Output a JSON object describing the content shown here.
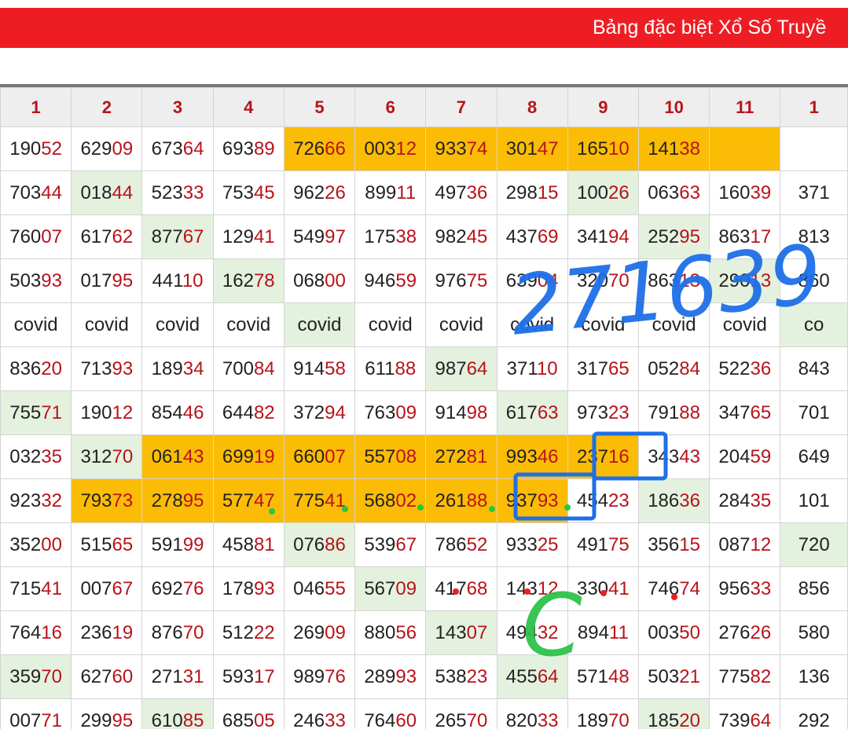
{
  "banner": {
    "title": "Bảng đặc biệt Xổ Số Truyề"
  },
  "colors": {
    "banner": "#ee1d24",
    "highlight_orange": "#fbbc05",
    "highlight_green": "#e3f1de",
    "tail_digits": "#b8131b"
  },
  "table": {
    "headers": [
      "1",
      "2",
      "3",
      "4",
      "5",
      "6",
      "7",
      "8",
      "9",
      "10",
      "11",
      "1"
    ],
    "rows": [
      [
        {
          "t": "19052",
          "s": "w"
        },
        {
          "t": "62909",
          "s": "w"
        },
        {
          "t": "67364",
          "s": "w"
        },
        {
          "t": "69389",
          "s": "w"
        },
        {
          "t": "72666",
          "s": "o"
        },
        {
          "t": "00312",
          "s": "o"
        },
        {
          "t": "93374",
          "s": "o"
        },
        {
          "t": "30147",
          "s": "o"
        },
        {
          "t": "16510",
          "s": "o"
        },
        {
          "t": "14138",
          "s": "o"
        },
        {
          "t": "",
          "s": "o"
        },
        {
          "t": "",
          "s": "w"
        }
      ],
      [
        {
          "t": "70344",
          "s": "w"
        },
        {
          "t": "01844",
          "s": "g"
        },
        {
          "t": "52333",
          "s": "w"
        },
        {
          "t": "75345",
          "s": "w"
        },
        {
          "t": "96226",
          "s": "w"
        },
        {
          "t": "89911",
          "s": "w"
        },
        {
          "t": "49736",
          "s": "w"
        },
        {
          "t": "29815",
          "s": "w"
        },
        {
          "t": "10026",
          "s": "g"
        },
        {
          "t": "06363",
          "s": "w"
        },
        {
          "t": "16039",
          "s": "w"
        },
        {
          "t": "371",
          "s": "w"
        }
      ],
      [
        {
          "t": "76007",
          "s": "w"
        },
        {
          "t": "61762",
          "s": "w"
        },
        {
          "t": "87767",
          "s": "g"
        },
        {
          "t": "12941",
          "s": "w"
        },
        {
          "t": "54997",
          "s": "w"
        },
        {
          "t": "17538",
          "s": "w"
        },
        {
          "t": "98245",
          "s": "w"
        },
        {
          "t": "43769",
          "s": "w"
        },
        {
          "t": "34194",
          "s": "w"
        },
        {
          "t": "25295",
          "s": "g"
        },
        {
          "t": "86317",
          "s": "w"
        },
        {
          "t": "813",
          "s": "w"
        }
      ],
      [
        {
          "t": "50393",
          "s": "w"
        },
        {
          "t": "01795",
          "s": "w"
        },
        {
          "t": "44110",
          "s": "w"
        },
        {
          "t": "16278",
          "s": "g"
        },
        {
          "t": "06800",
          "s": "w"
        },
        {
          "t": "94659",
          "s": "w"
        },
        {
          "t": "97675",
          "s": "w"
        },
        {
          "t": "63904",
          "s": "w"
        },
        {
          "t": "32070",
          "s": "w"
        },
        {
          "t": "86313",
          "s": "w"
        },
        {
          "t": "29013",
          "s": "g"
        },
        {
          "t": "860",
          "s": "w"
        }
      ],
      [
        {
          "t": "covid",
          "s": "w",
          "plain": true
        },
        {
          "t": "covid",
          "s": "w",
          "plain": true
        },
        {
          "t": "covid",
          "s": "w",
          "plain": true
        },
        {
          "t": "covid",
          "s": "w",
          "plain": true
        },
        {
          "t": "covid",
          "s": "g",
          "plain": true
        },
        {
          "t": "covid",
          "s": "w",
          "plain": true
        },
        {
          "t": "covid",
          "s": "w",
          "plain": true
        },
        {
          "t": "covid",
          "s": "w",
          "plain": true
        },
        {
          "t": "covid",
          "s": "w",
          "plain": true
        },
        {
          "t": "covid",
          "s": "w",
          "plain": true
        },
        {
          "t": "covid",
          "s": "w",
          "plain": true
        },
        {
          "t": "co",
          "s": "g",
          "plain": true
        }
      ],
      [
        {
          "t": "83620",
          "s": "w"
        },
        {
          "t": "71393",
          "s": "w"
        },
        {
          "t": "18934",
          "s": "w"
        },
        {
          "t": "70084",
          "s": "w"
        },
        {
          "t": "91458",
          "s": "w"
        },
        {
          "t": "61188",
          "s": "w"
        },
        {
          "t": "98764",
          "s": "g"
        },
        {
          "t": "37110",
          "s": "w"
        },
        {
          "t": "31765",
          "s": "w"
        },
        {
          "t": "05284",
          "s": "w"
        },
        {
          "t": "52236",
          "s": "w"
        },
        {
          "t": "843",
          "s": "w"
        }
      ],
      [
        {
          "t": "75571",
          "s": "g"
        },
        {
          "t": "19012",
          "s": "w"
        },
        {
          "t": "85446",
          "s": "w"
        },
        {
          "t": "64482",
          "s": "w"
        },
        {
          "t": "37294",
          "s": "w"
        },
        {
          "t": "76309",
          "s": "w"
        },
        {
          "t": "91498",
          "s": "w"
        },
        {
          "t": "61763",
          "s": "g"
        },
        {
          "t": "97323",
          "s": "w"
        },
        {
          "t": "79188",
          "s": "w"
        },
        {
          "t": "34765",
          "s": "w"
        },
        {
          "t": "701",
          "s": "w"
        }
      ],
      [
        {
          "t": "03235",
          "s": "w"
        },
        {
          "t": "31270",
          "s": "g"
        },
        {
          "t": "06143",
          "s": "o"
        },
        {
          "t": "69919",
          "s": "o"
        },
        {
          "t": "66007",
          "s": "o"
        },
        {
          "t": "55708",
          "s": "o"
        },
        {
          "t": "27281",
          "s": "o"
        },
        {
          "t": "99346",
          "s": "o"
        },
        {
          "t": "23716",
          "s": "o"
        },
        {
          "t": "34343",
          "s": "w"
        },
        {
          "t": "20459",
          "s": "w"
        },
        {
          "t": "649",
          "s": "w"
        }
      ],
      [
        {
          "t": "92332",
          "s": "w"
        },
        {
          "t": "79373",
          "s": "o"
        },
        {
          "t": "27895",
          "s": "o"
        },
        {
          "t": "57747",
          "s": "o"
        },
        {
          "t": "77541",
          "s": "o"
        },
        {
          "t": "56802",
          "s": "o"
        },
        {
          "t": "26188",
          "s": "o"
        },
        {
          "t": "93793",
          "s": "o"
        },
        {
          "t": "45423",
          "s": "w"
        },
        {
          "t": "18636",
          "s": "g"
        },
        {
          "t": "28435",
          "s": "w"
        },
        {
          "t": "101",
          "s": "w"
        }
      ],
      [
        {
          "t": "35200",
          "s": "w"
        },
        {
          "t": "51565",
          "s": "w"
        },
        {
          "t": "59199",
          "s": "w"
        },
        {
          "t": "45881",
          "s": "w"
        },
        {
          "t": "07686",
          "s": "g"
        },
        {
          "t": "53967",
          "s": "w"
        },
        {
          "t": "78652",
          "s": "w"
        },
        {
          "t": "93325",
          "s": "w"
        },
        {
          "t": "49175",
          "s": "w"
        },
        {
          "t": "35615",
          "s": "w"
        },
        {
          "t": "08712",
          "s": "w"
        },
        {
          "t": "720",
          "s": "g"
        }
      ],
      [
        {
          "t": "71541",
          "s": "w"
        },
        {
          "t": "00767",
          "s": "w"
        },
        {
          "t": "69276",
          "s": "w"
        },
        {
          "t": "17893",
          "s": "w"
        },
        {
          "t": "04655",
          "s": "w"
        },
        {
          "t": "56709",
          "s": "g"
        },
        {
          "t": "41768",
          "s": "w"
        },
        {
          "t": "14312",
          "s": "w"
        },
        {
          "t": "33041",
          "s": "w"
        },
        {
          "t": "74674",
          "s": "w"
        },
        {
          "t": "95633",
          "s": "w"
        },
        {
          "t": "856",
          "s": "w"
        }
      ],
      [
        {
          "t": "76416",
          "s": "w"
        },
        {
          "t": "23619",
          "s": "w"
        },
        {
          "t": "87670",
          "s": "w"
        },
        {
          "t": "51222",
          "s": "w"
        },
        {
          "t": "26909",
          "s": "w"
        },
        {
          "t": "88056",
          "s": "w"
        },
        {
          "t": "14307",
          "s": "g"
        },
        {
          "t": "49432",
          "s": "w"
        },
        {
          "t": "89411",
          "s": "w"
        },
        {
          "t": "00350",
          "s": "w"
        },
        {
          "t": "27626",
          "s": "w"
        },
        {
          "t": "580",
          "s": "w"
        }
      ],
      [
        {
          "t": "35970",
          "s": "g"
        },
        {
          "t": "62760",
          "s": "w"
        },
        {
          "t": "27131",
          "s": "w"
        },
        {
          "t": "59317",
          "s": "w"
        },
        {
          "t": "98976",
          "s": "w"
        },
        {
          "t": "28993",
          "s": "w"
        },
        {
          "t": "53823",
          "s": "w"
        },
        {
          "t": "45564",
          "s": "g"
        },
        {
          "t": "57148",
          "s": "w"
        },
        {
          "t": "50321",
          "s": "w"
        },
        {
          "t": "77582",
          "s": "w"
        },
        {
          "t": "136",
          "s": "w"
        }
      ],
      [
        {
          "t": "00771",
          "s": "w"
        },
        {
          "t": "29995",
          "s": "w"
        },
        {
          "t": "61085",
          "s": "g"
        },
        {
          "t": "68505",
          "s": "w"
        },
        {
          "t": "24633",
          "s": "w"
        },
        {
          "t": "76460",
          "s": "w"
        },
        {
          "t": "26570",
          "s": "w"
        },
        {
          "t": "82033",
          "s": "w"
        },
        {
          "t": "18970",
          "s": "w"
        },
        {
          "t": "18520",
          "s": "g"
        },
        {
          "t": "73964",
          "s": "w"
        },
        {
          "t": "292",
          "s": "w"
        }
      ]
    ]
  },
  "annotations": {
    "handwritten_number": "271639",
    "handwritten_letter": "C"
  }
}
